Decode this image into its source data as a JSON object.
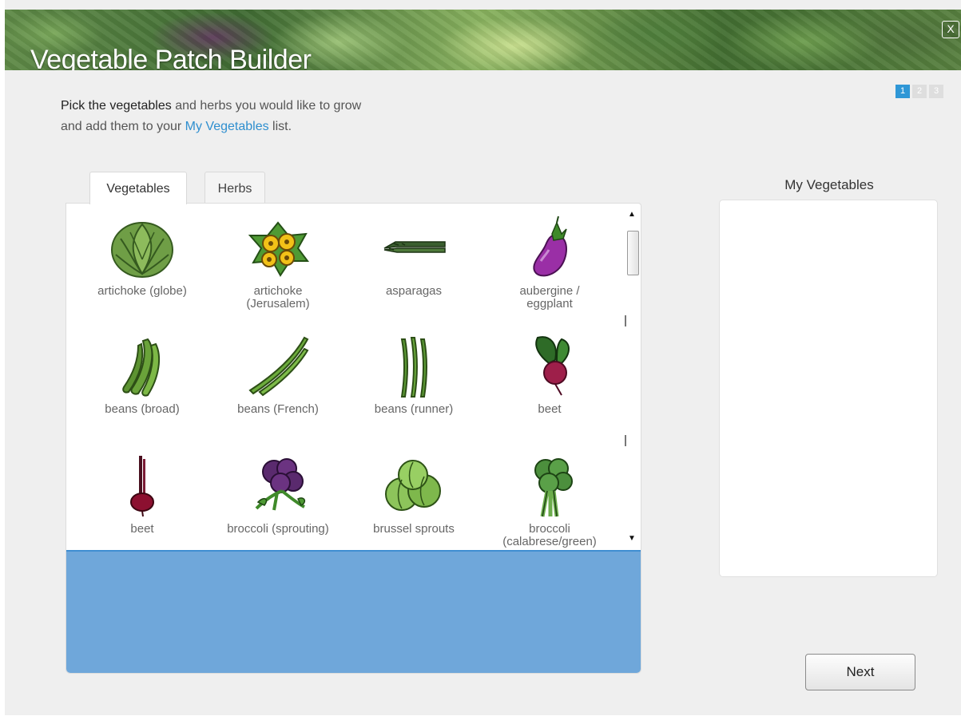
{
  "app": {
    "title": "Vegetable Patch Builder",
    "close_label": "X"
  },
  "steps": [
    "1",
    "2",
    "3"
  ],
  "active_step": 1,
  "intro": {
    "bold": "Pick the vegetables",
    "text1": " and herbs you would like to grow",
    "text2": "and add them to your ",
    "link": "My Vegetables",
    "text3": " list."
  },
  "tabs": [
    {
      "label": "Vegetables",
      "active": true
    },
    {
      "label": "Herbs",
      "active": false
    }
  ],
  "vegetables": [
    {
      "label": "artichoke (globe)",
      "icon": "artichoke-icon"
    },
    {
      "label": "artichoke\n(Jerusalem)",
      "icon": "jerusalem-artichoke-icon"
    },
    {
      "label": "asparagas",
      "icon": "asparagus-icon"
    },
    {
      "label": "aubergine /\neggplant",
      "icon": "aubergine-icon"
    },
    {
      "label": "beans (broad)",
      "icon": "broad-beans-icon"
    },
    {
      "label": "beans (French)",
      "icon": "french-beans-icon"
    },
    {
      "label": "beans (runner)",
      "icon": "runner-beans-icon"
    },
    {
      "label": "beet",
      "icon": "beet-leafy-icon"
    },
    {
      "label": "beet",
      "icon": "beet-root-icon"
    },
    {
      "label": "broccoli (sprouting)",
      "icon": "purple-broccoli-icon"
    },
    {
      "label": "brussel sprouts",
      "icon": "brussel-sprouts-icon"
    },
    {
      "label": "broccoli\n(calabrese/green)",
      "icon": "green-broccoli-icon"
    }
  ],
  "my_vegetables": {
    "title": "My Vegetables",
    "items": []
  },
  "buttons": {
    "next": "Next"
  },
  "colors": {
    "accent": "#2f97d6",
    "dropzone": "#6fa7da",
    "link": "#2f8fcf"
  }
}
